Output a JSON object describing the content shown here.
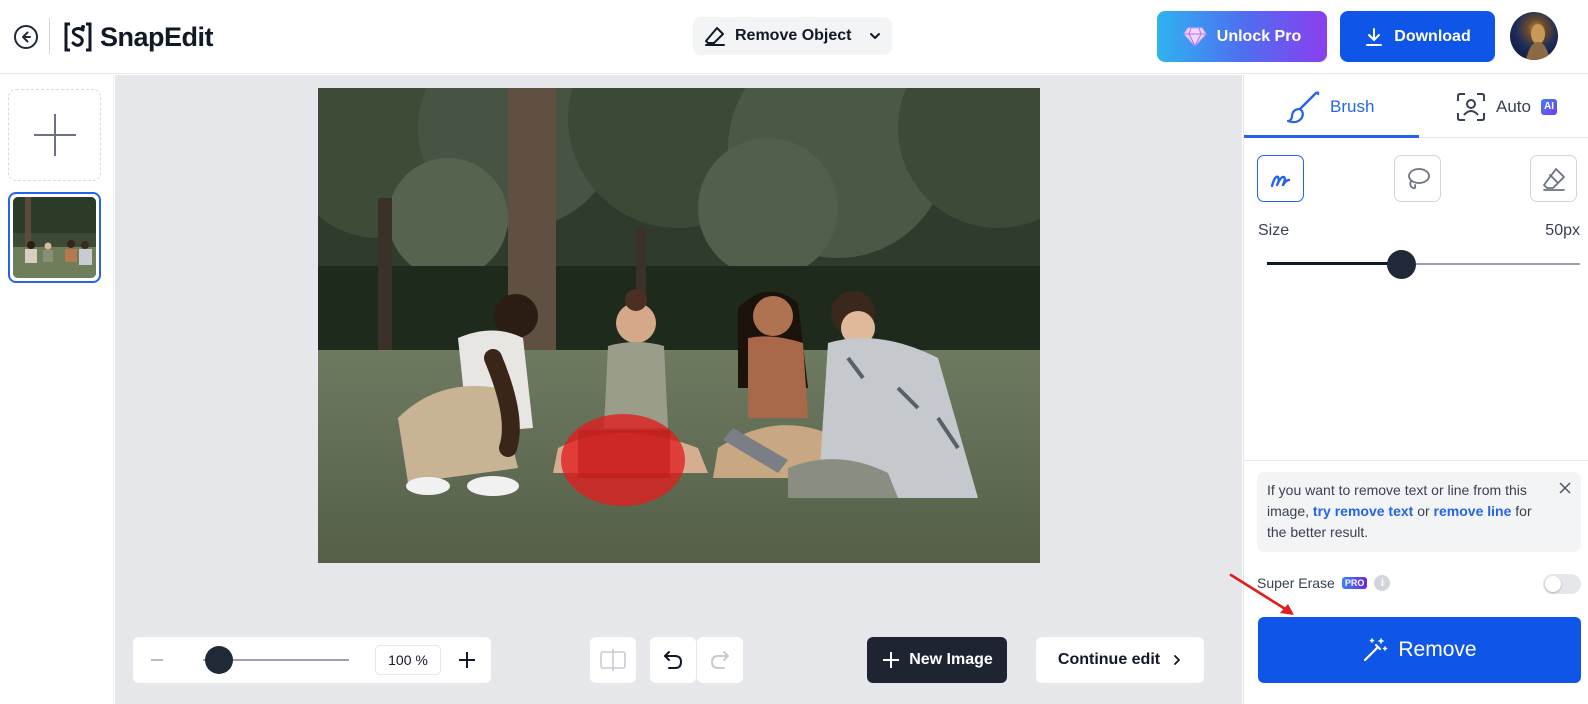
{
  "header": {
    "app_name": "SnapEdit",
    "tool_select": {
      "label": "Remove Object"
    },
    "unlock_label": "Unlock Pro",
    "download_label": "Download"
  },
  "canvas": {
    "zoom_value": "100 %",
    "zoom_level": 0.0,
    "new_image_label": "New Image",
    "continue_label": "Continue edit"
  },
  "panel": {
    "tabs": [
      {
        "label": "Brush",
        "active": true
      },
      {
        "label": "Auto",
        "badge": "AI",
        "active": false
      }
    ],
    "modes": [
      "brush-icon",
      "lasso-icon",
      "eraser-icon"
    ],
    "size_label": "Size",
    "size_value": "50px",
    "size_level": 0.43,
    "info": {
      "text_before": "If you want to remove text or line from this image, ",
      "link1": "try remove text",
      "text_middle": " or ",
      "link2": "remove line",
      "text_after": " for the better result."
    },
    "super_erase_label": "Super Erase",
    "pro_badge": "PRO",
    "super_erase_enabled": false,
    "remove_label": "Remove"
  },
  "colors": {
    "primary": "#0f56e8",
    "brush_mask": "#e11d1d",
    "dark_button": "#1f2433"
  }
}
